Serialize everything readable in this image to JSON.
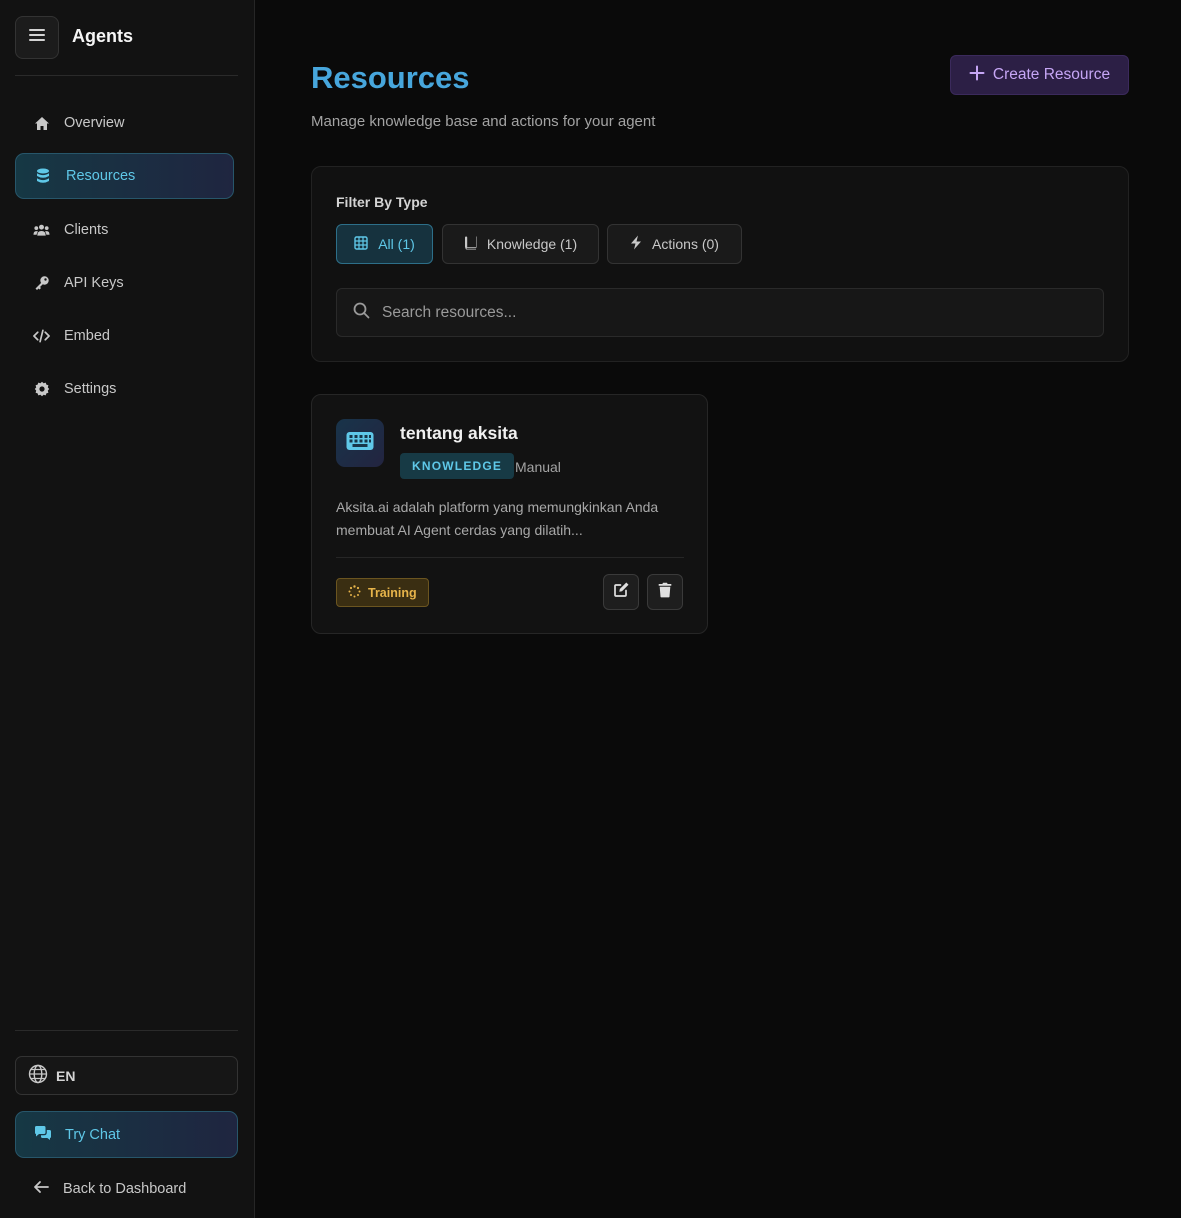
{
  "sidebar": {
    "app_title": "Agents",
    "items": [
      {
        "label": "Overview",
        "icon": "home-icon"
      },
      {
        "label": "Resources",
        "icon": "database-icon",
        "active": true
      },
      {
        "label": "Clients",
        "icon": "users-icon"
      },
      {
        "label": "API Keys",
        "icon": "key-icon"
      },
      {
        "label": "Embed",
        "icon": "code-icon"
      },
      {
        "label": "Settings",
        "icon": "gear-icon"
      }
    ],
    "language": "EN",
    "try_chat": "Try Chat",
    "back_to_dashboard": "Back to Dashboard"
  },
  "header": {
    "title": "Resources",
    "subtitle": "Manage knowledge base and actions for your agent",
    "create_button": "Create Resource"
  },
  "filter": {
    "label": "Filter By Type",
    "chips": [
      {
        "label": "All (1)",
        "icon": "grid-icon",
        "active": true
      },
      {
        "label": "Knowledge (1)",
        "icon": "book-icon"
      },
      {
        "label": "Actions (0)",
        "icon": "bolt-icon"
      }
    ],
    "search_placeholder": "Search resources..."
  },
  "resources": [
    {
      "title": "tentang aksita",
      "type": "KNOWLEDGE",
      "source": "Manual",
      "description": "Aksita.ai adalah platform yang memungkinkan Anda membuat AI Agent cerdas yang dilatih...",
      "status": "Training"
    }
  ],
  "colors": {
    "accent_cyan": "#5fc8e8",
    "title_blue": "#47a6dc",
    "purple": "#c6a6f5",
    "warning": "#e7b44a"
  }
}
